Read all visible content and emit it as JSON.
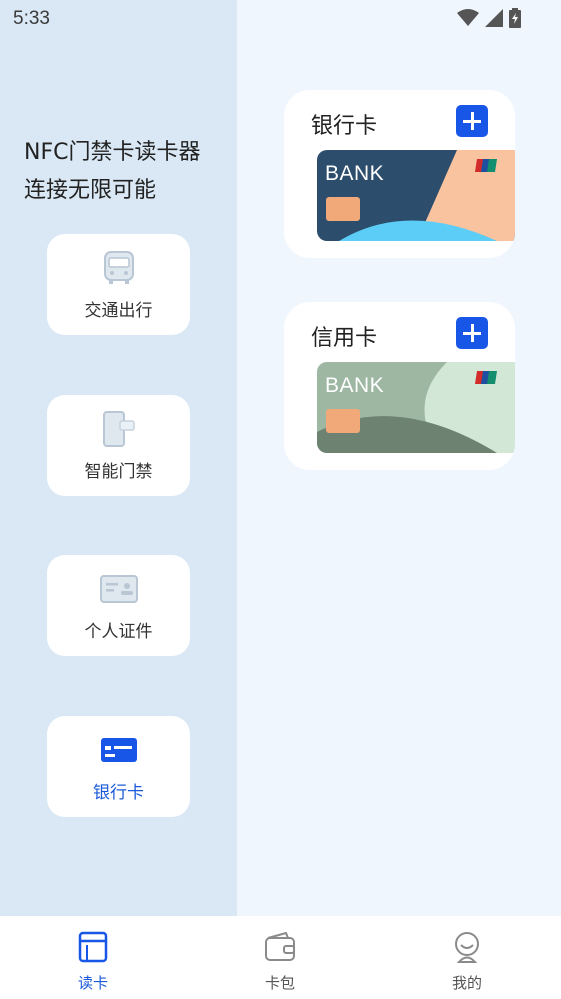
{
  "status_bar": {
    "time": "5:33"
  },
  "intro": {
    "line1": "NFC门禁卡读卡器",
    "line2": "连接无限可能"
  },
  "nav": [
    {
      "label": "交通出行",
      "icon": "bus-icon",
      "active": false
    },
    {
      "label": "智能门禁",
      "icon": "door-access-icon",
      "active": false
    },
    {
      "label": "个人证件",
      "icon": "id-card-icon",
      "active": false
    },
    {
      "label": "银行卡",
      "icon": "bank-card-icon",
      "active": true
    }
  ],
  "card_groups": [
    {
      "title": "银行卡",
      "card_text": "BANK"
    },
    {
      "title": "信用卡",
      "card_text": "BANK"
    }
  ],
  "tabs": [
    {
      "label": "读卡",
      "icon": "read-card-icon",
      "active": true
    },
    {
      "label": "卡包",
      "icon": "wallet-icon",
      "active": false
    },
    {
      "label": "我的",
      "icon": "profile-icon",
      "active": false
    }
  ],
  "colors": {
    "accent": "#1756e6",
    "left_bg": "#d9e8f4",
    "right_bg": "#eff6fd"
  }
}
